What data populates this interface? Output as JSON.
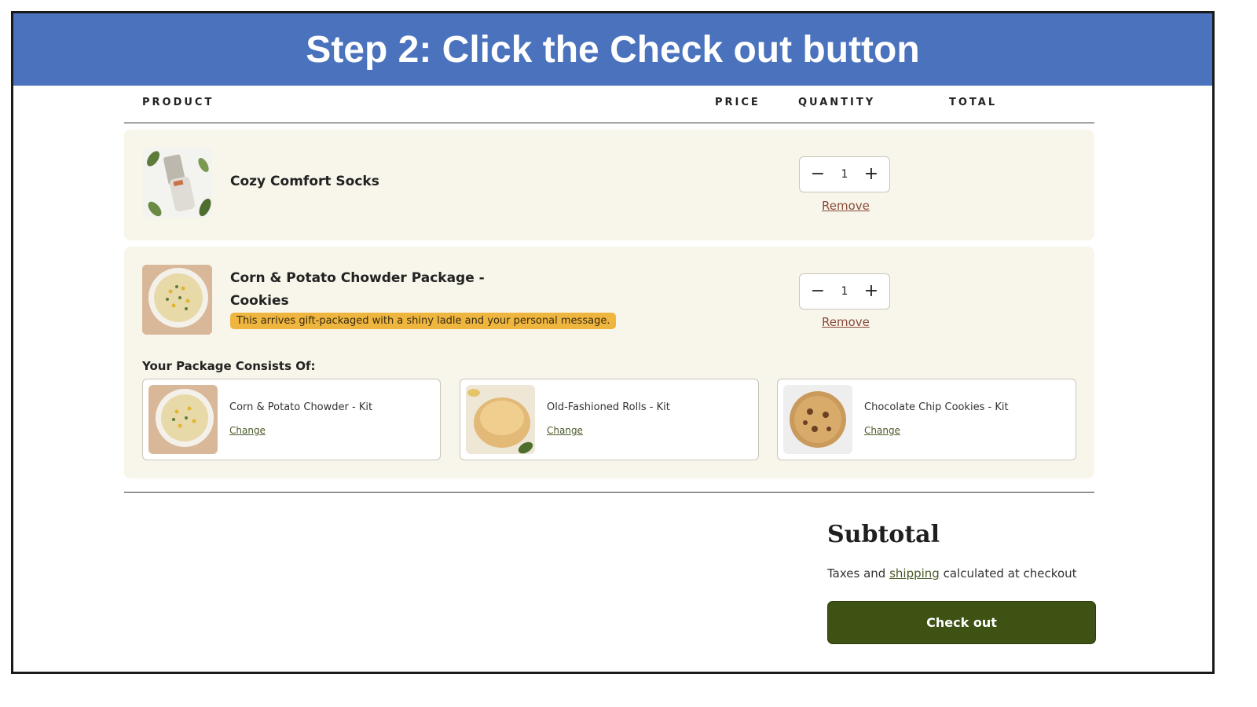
{
  "banner": {
    "title": "Step 2: Click the Check out button"
  },
  "table": {
    "headers": {
      "product": "PRODUCT",
      "price": "PRICE",
      "quantity": "QUANTITY",
      "total": "TOTAL"
    }
  },
  "items": [
    {
      "name": "Cozy Comfort Socks",
      "quantity": "1",
      "remove_label": "Remove",
      "thumb_icon": "socks-photo"
    },
    {
      "name_line1": "Corn & Potato Chowder Package -",
      "name_line2": "Cookies",
      "gift_note": "This arrives gift-packaged with a shiny ladle and your personal message.",
      "quantity": "1",
      "remove_label": "Remove",
      "thumb_icon": "chowder-photo",
      "package_title": "Your Package Consists Of:",
      "components": [
        {
          "name": "Corn & Potato Chowder - Kit",
          "change_label": "Change",
          "thumb_icon": "chowder-photo"
        },
        {
          "name": "Old-Fashioned Rolls - Kit",
          "change_label": "Change",
          "thumb_icon": "roll-photo"
        },
        {
          "name": "Chocolate Chip Cookies - Kit",
          "change_label": "Change",
          "thumb_icon": "cookie-photo"
        }
      ]
    }
  ],
  "summary": {
    "subtotal_label": "Subtotal",
    "taxes_prefix": "Taxes and ",
    "shipping_link": "shipping",
    "taxes_suffix": " calculated at checkout",
    "checkout_label": "Check out"
  },
  "colors": {
    "banner": "#4a72bd",
    "card": "#f8f5ea",
    "checkout": "#3e5213",
    "gift": "#eeb53f",
    "remove": "#8a4b3a"
  }
}
